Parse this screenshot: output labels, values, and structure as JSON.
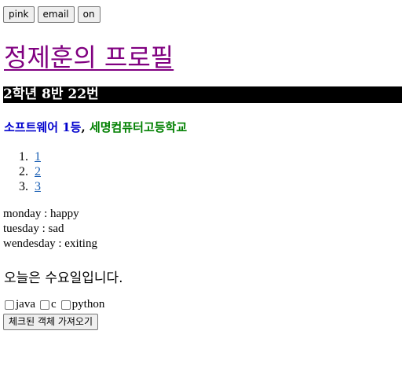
{
  "toolbar": {
    "pink_label": "pink",
    "email_label": "email",
    "on_label": "on"
  },
  "profile": {
    "title": "정제훈의 프로필",
    "class_info": "2학년 8반 22번",
    "awards": {
      "first": "소프트웨어 1등",
      "separator": ",",
      "second": "세명컴퓨터고등학교",
      "first_color": "#0000cd",
      "second_color": "#008000"
    }
  },
  "links": [
    {
      "num": "1.",
      "label": "1"
    },
    {
      "num": "2.",
      "label": "2"
    },
    {
      "num": "3.",
      "label": "3"
    }
  ],
  "moods": [
    "monday : happy",
    "tuesday : sad",
    "wendesday : exiting"
  ],
  "today_text": "오늘은 수요일입니다.",
  "languages": [
    {
      "label": "java",
      "checked": false
    },
    {
      "label": "c",
      "checked": false
    },
    {
      "label": "python",
      "checked": false
    }
  ],
  "get_checked_label": "체크된 객체 가져오기"
}
